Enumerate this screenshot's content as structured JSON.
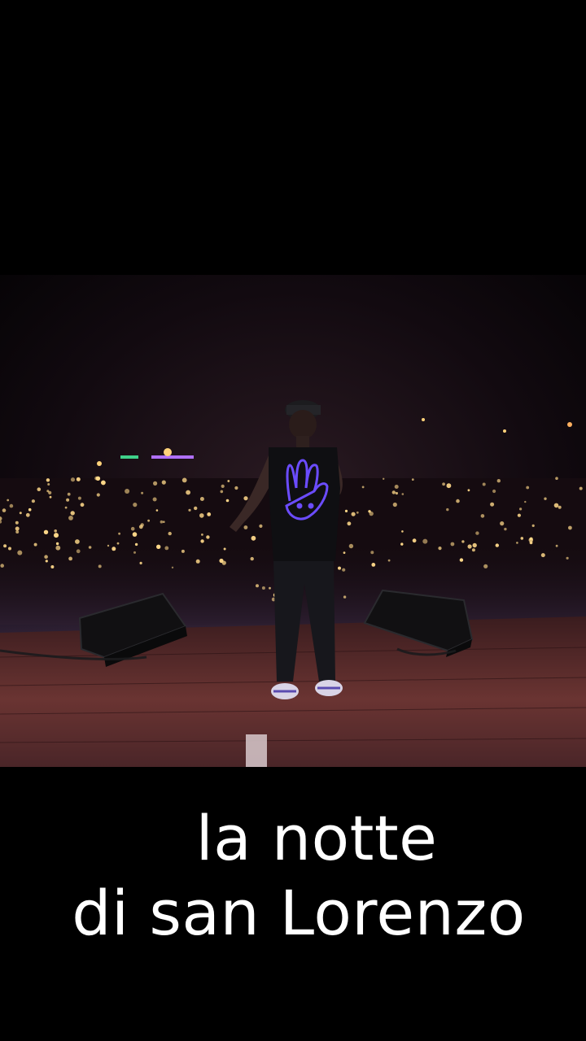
{
  "caption": {
    "line1": "la notte",
    "line2": "di san Lorenzo"
  },
  "colors": {
    "background": "#000000",
    "caption_text": "#ffffff",
    "crowd_light": "#ffd98a",
    "stage_floor": "#5a2a2a",
    "shirt_logo": "#6b4cff"
  }
}
